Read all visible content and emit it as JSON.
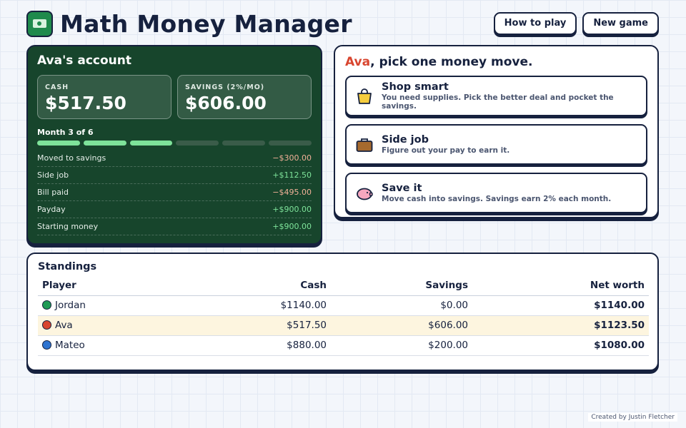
{
  "header": {
    "title": "Math Money Manager",
    "icon": "money-bill-icon",
    "buttons": {
      "how_to_play": "How to play",
      "new_game": "New game"
    }
  },
  "account": {
    "title": "Ava's account",
    "cash_label": "CASH",
    "cash_value": "$517.50",
    "savings_label": "SAVINGS (2%/MO)",
    "savings_value": "$606.00",
    "month_label": "Month 3 of 6",
    "months_completed": 3,
    "months_total": 6,
    "ledger": [
      {
        "label": "Moved to savings",
        "amount": "−$300.00",
        "type": "neg"
      },
      {
        "label": "Side job",
        "amount": "+$112.50",
        "type": "pos"
      },
      {
        "label": "Bill paid",
        "amount": "−$495.00",
        "type": "neg"
      },
      {
        "label": "Payday",
        "amount": "+$900.00",
        "type": "pos"
      },
      {
        "label": "Starting money",
        "amount": "+$900.00",
        "type": "pos"
      }
    ]
  },
  "moves": {
    "player_name": "Ava",
    "prompt_rest": ", pick one money move.",
    "options": [
      {
        "title": "Shop smart",
        "desc": "You need supplies. Pick the better deal and pocket the savings.",
        "icon": "shopping-bag-icon"
      },
      {
        "title": "Side job",
        "desc": "Figure out your pay to earn it.",
        "icon": "briefcase-icon"
      },
      {
        "title": "Save it",
        "desc": "Move cash into savings. Savings earn 2% each month.",
        "icon": "piggy-bank-icon"
      }
    ]
  },
  "standings": {
    "title": "Standings",
    "columns": [
      "Player",
      "Cash",
      "Savings",
      "Net worth"
    ],
    "rows": [
      {
        "player": "Jordan",
        "color": "#1f9a55",
        "cash": "$1140.00",
        "savings": "$0.00",
        "net_worth": "$1140.00"
      },
      {
        "player": "Ava",
        "color": "#d8452f",
        "cash": "$517.50",
        "savings": "$606.00",
        "net_worth": "$1123.50",
        "current": true
      },
      {
        "player": "Mateo",
        "color": "#2f74d0",
        "cash": "$880.00",
        "savings": "$200.00",
        "net_worth": "$1080.00"
      }
    ]
  },
  "credit": "Created by Justin Fletcher"
}
